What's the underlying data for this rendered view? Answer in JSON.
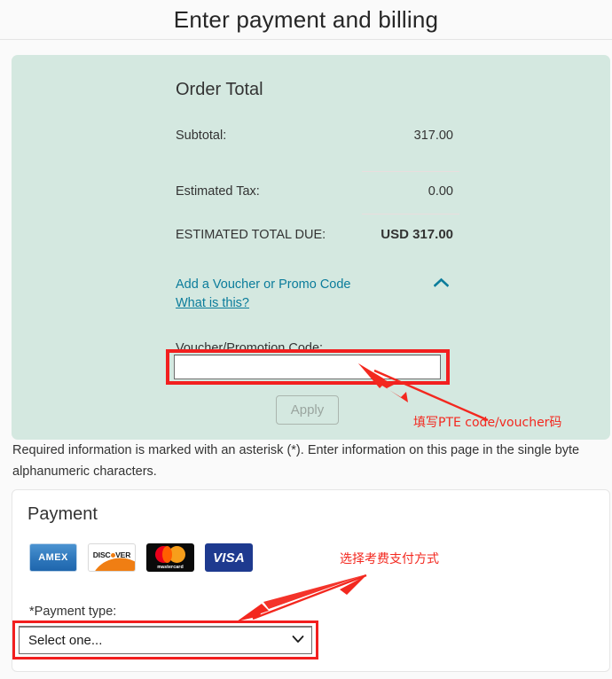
{
  "header": {
    "title": "Enter payment and billing"
  },
  "order_panel": {
    "title": "Order Total",
    "rows": [
      {
        "label": "Subtotal:",
        "value": "317.00"
      },
      {
        "label": "Estimated Tax:",
        "value": "0.00"
      },
      {
        "label": "ESTIMATED TOTAL DUE:",
        "value": "USD 317.00"
      }
    ],
    "voucher_toggle_label": "Add a Voucher or Promo Code",
    "what_is_this_label": "What is this?",
    "collapse_icon": "chevron-up-icon",
    "voucher_field_label": "Voucher/Promotion Code:",
    "voucher_input_value": "",
    "voucher_input_placeholder": "",
    "apply_button_label": "Apply"
  },
  "annotations": [
    {
      "text": "填写PTE code/voucher码",
      "color": "#f3281f"
    },
    {
      "text": "选择考费支付方式",
      "color": "#f3281f"
    }
  ],
  "required_note": "Required information is marked with an asterisk (*). Enter information on this page in the single byte alphanumeric characters.",
  "payment": {
    "title": "Payment",
    "accepted_cards": [
      {
        "name": "amex-card-logo",
        "label": "AMEX"
      },
      {
        "name": "discover-card-logo",
        "label": "DISC VER"
      },
      {
        "name": "mastercard-card-logo",
        "label": "mastercard"
      },
      {
        "name": "visa-card-logo",
        "label": "VISA"
      }
    ],
    "payment_type_label": "*Payment type:",
    "payment_type_selected": "Select one...",
    "payment_type_options": [
      "Select one..."
    ]
  },
  "colors": {
    "panel_mint": "#d4e8e0",
    "page_bg": "#fafafa",
    "link_teal": "#0b7c9b",
    "annotation_red": "#f3281f",
    "highlight_red": "#f21f1f"
  }
}
